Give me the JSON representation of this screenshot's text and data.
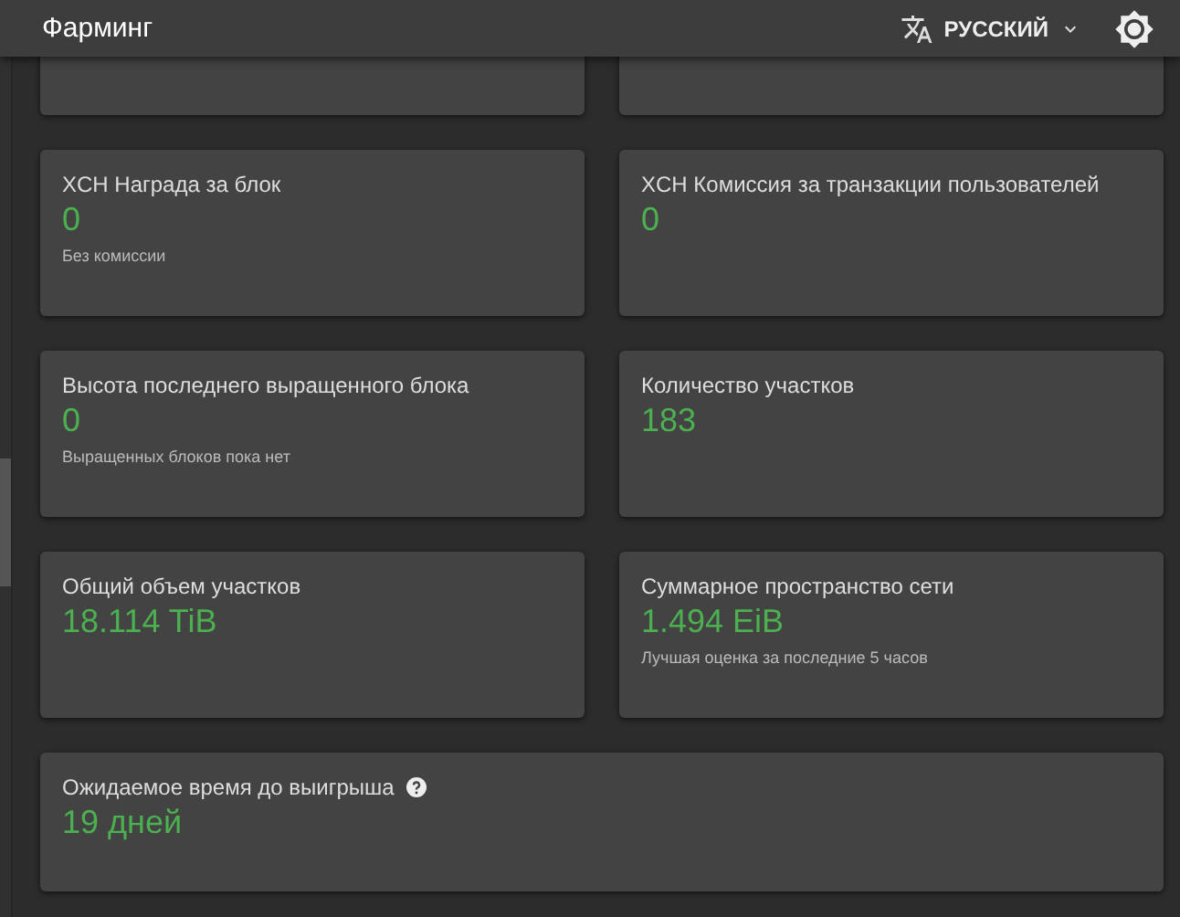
{
  "app_bar": {
    "title": "Фарминг",
    "language": "РУССКИЙ"
  },
  "cards": [
    {
      "title": "XCH Награда за блок",
      "value": "0",
      "note": "Без комиссии"
    },
    {
      "title": "XCH Комиссия за транзакции пользователей",
      "value": "0"
    },
    {
      "title": "Высота последнего выращенного блока",
      "value": "0",
      "note": "Выращенных блоков пока нет"
    },
    {
      "title": "Количество участков",
      "value": "183"
    },
    {
      "title": "Общий объем участков",
      "value": "18.114 TiB"
    },
    {
      "title": "Суммарное пространство сети",
      "value": "1.494 EiB",
      "note": "Лучшая оценка за последние 5 часов"
    },
    {
      "title": "Ожидаемое время до выигрыша",
      "value": "19 дней",
      "help": true,
      "wide": true
    }
  ]
}
